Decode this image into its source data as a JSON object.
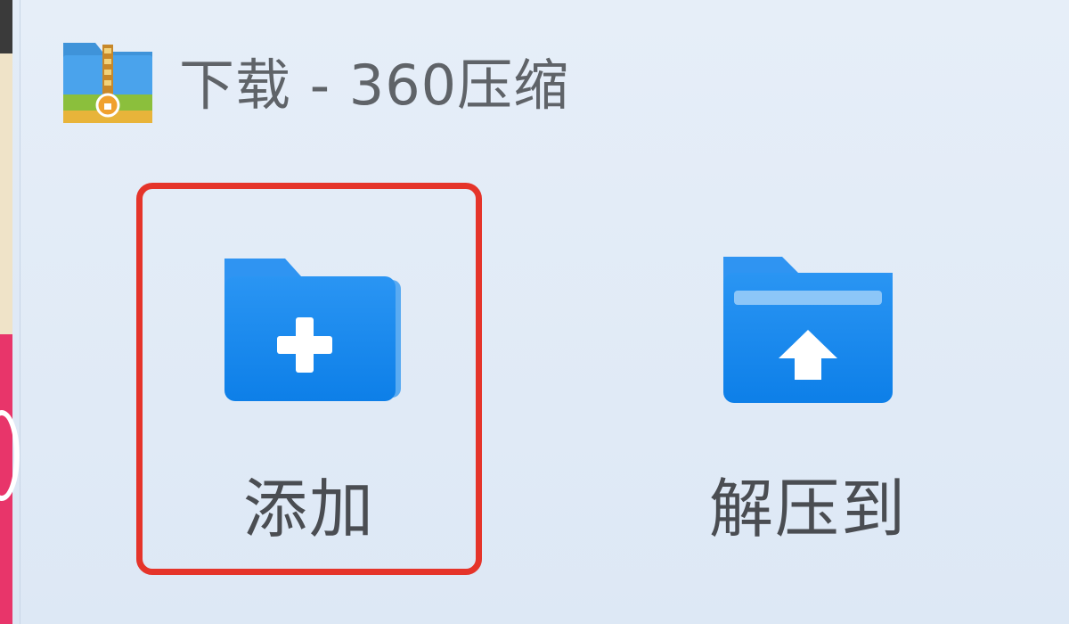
{
  "window": {
    "title": "下载 - 360压缩",
    "app_icon": "360-zip-archive-icon"
  },
  "toolbar": {
    "add": {
      "label": "添加",
      "icon": "folder-plus-icon",
      "highlighted": true
    },
    "extract": {
      "label": "解压到",
      "icon": "folder-upload-icon"
    }
  },
  "colors": {
    "highlight_border": "#e5342a",
    "folder_blue": "#1e8ef0",
    "title_text": "#5f6368"
  }
}
